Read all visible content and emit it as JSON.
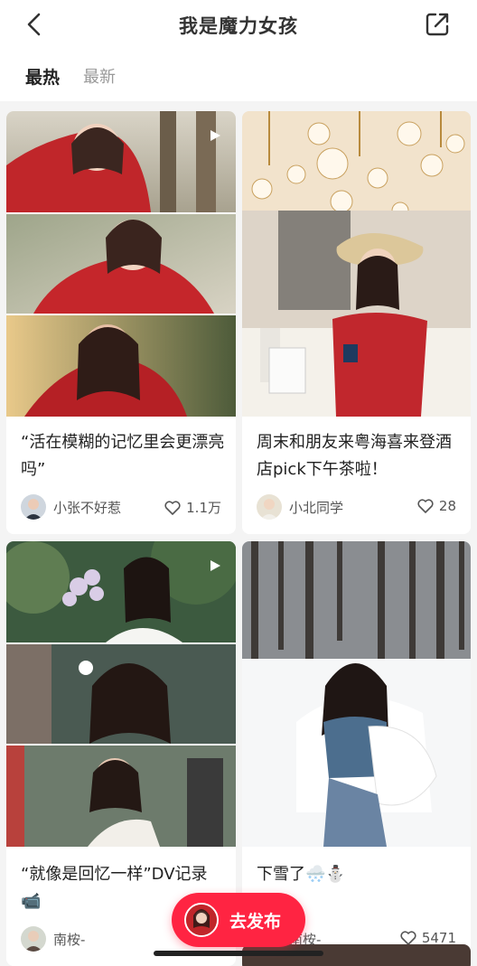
{
  "header": {
    "title": "我是魔力女孩",
    "back_icon": "chevron-left-icon",
    "share_icon": "share-export-icon"
  },
  "tabs": [
    {
      "label": "最热",
      "active": true
    },
    {
      "label": "最新",
      "active": false
    }
  ],
  "posts": [
    {
      "caption": "“活在模糊的记忆里会更漂亮吗”",
      "author": "小张不好惹",
      "likes": "1.1万",
      "is_video": true
    },
    {
      "caption": "周末和朋友来粤海喜来登酒店pick下午茶啦！",
      "author": "小北同学",
      "likes": "28",
      "is_video": false
    },
    {
      "caption": "“就像是回忆一样”DV记录📹",
      "author": "南桉-",
      "likes": "",
      "is_video": true
    },
    {
      "caption": "下雪了🌨️⛄",
      "author": "南桉-",
      "likes": "5471",
      "is_video": false
    }
  ],
  "fab": {
    "label": "去发布"
  },
  "colors": {
    "accent": "#ff2442",
    "background": "#f4f4f4"
  }
}
